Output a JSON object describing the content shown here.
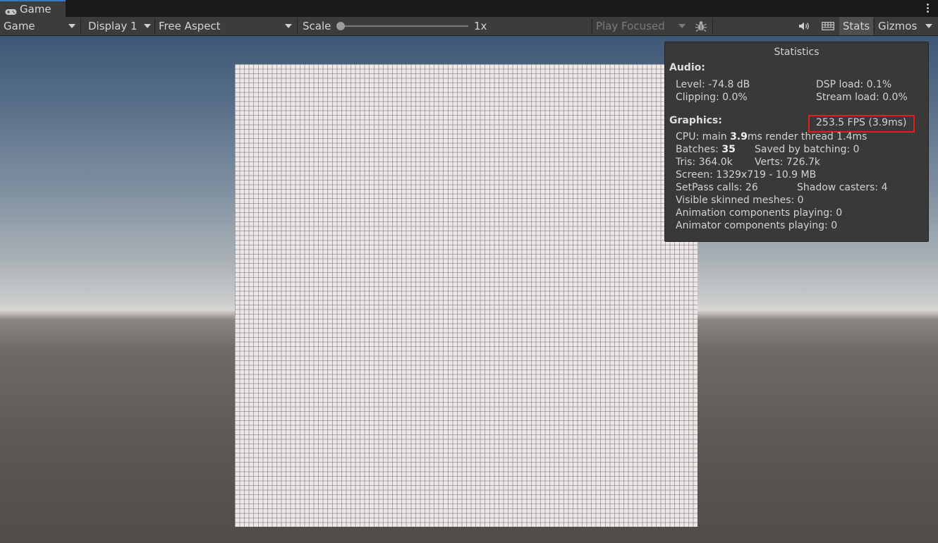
{
  "tab": {
    "label": "Game",
    "icon": "gamepad-icon"
  },
  "toolbar": {
    "view_mode": "Game",
    "display": "Display 1",
    "aspect": "Free Aspect",
    "scale_label": "Scale",
    "scale_value": "1x",
    "play_mode": "Play Focused",
    "stats_label": "Stats",
    "gizmos_label": "Gizmos",
    "icons": {
      "debug": "bug-icon",
      "audio": "speaker-icon",
      "keyboard": "keyboard-icon",
      "menu": "kebab-menu-icon"
    }
  },
  "stats": {
    "title": "Statistics",
    "audio_header": "Audio:",
    "level": "Level: -74.8 dB",
    "dsp_load": "DSP load: 0.1%",
    "clipping": "Clipping: 0.0%",
    "stream_load": "Stream load: 0.0%",
    "graphics_header": "Graphics:",
    "fps": "253.5 FPS (3.9ms)",
    "cpu_prefix": "CPU: main ",
    "cpu_main": "3.9",
    "cpu_suffix": "ms  render thread 1.4ms",
    "batches_prefix": "Batches: ",
    "batches": "35",
    "saved_by_batching": "Saved by batching: 0",
    "tris": "Tris: 364.0k",
    "verts": "Verts: 726.7k",
    "screen": "Screen: 1329x719 - 10.9 MB",
    "setpass": "SetPass calls: 26",
    "shadow_casters": "Shadow casters: 4",
    "skinned_meshes": "Visible skinned meshes: 0",
    "animation_components": "Animation components playing: 0",
    "animator_components": "Animator components playing: 0"
  },
  "colors": {
    "highlight": "#e0201c",
    "tab_accent": "#3a79bb"
  }
}
